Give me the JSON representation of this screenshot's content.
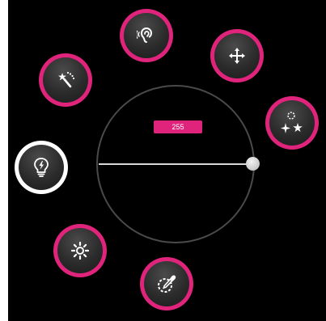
{
  "slider": {
    "value_label": "255",
    "level": 1.0
  },
  "colors": {
    "accent": "#e0247c",
    "background": "#000000",
    "button_face": "#2b2b2b",
    "selected_ring": "#ffffff"
  },
  "buttons": [
    {
      "id": "ear",
      "icon": "ear-icon",
      "selected": false
    },
    {
      "id": "move",
      "icon": "move-arrows-icon",
      "selected": false
    },
    {
      "id": "magic",
      "icon": "magic-wand-icon",
      "selected": false
    },
    {
      "id": "effects",
      "icon": "sparkle-stars-icon",
      "selected": false
    },
    {
      "id": "light",
      "icon": "lightbulb-icon",
      "selected": true
    },
    {
      "id": "brightness",
      "icon": "sun-icon",
      "selected": false
    },
    {
      "id": "color-pick",
      "icon": "eyedropper-icon",
      "selected": false
    }
  ]
}
